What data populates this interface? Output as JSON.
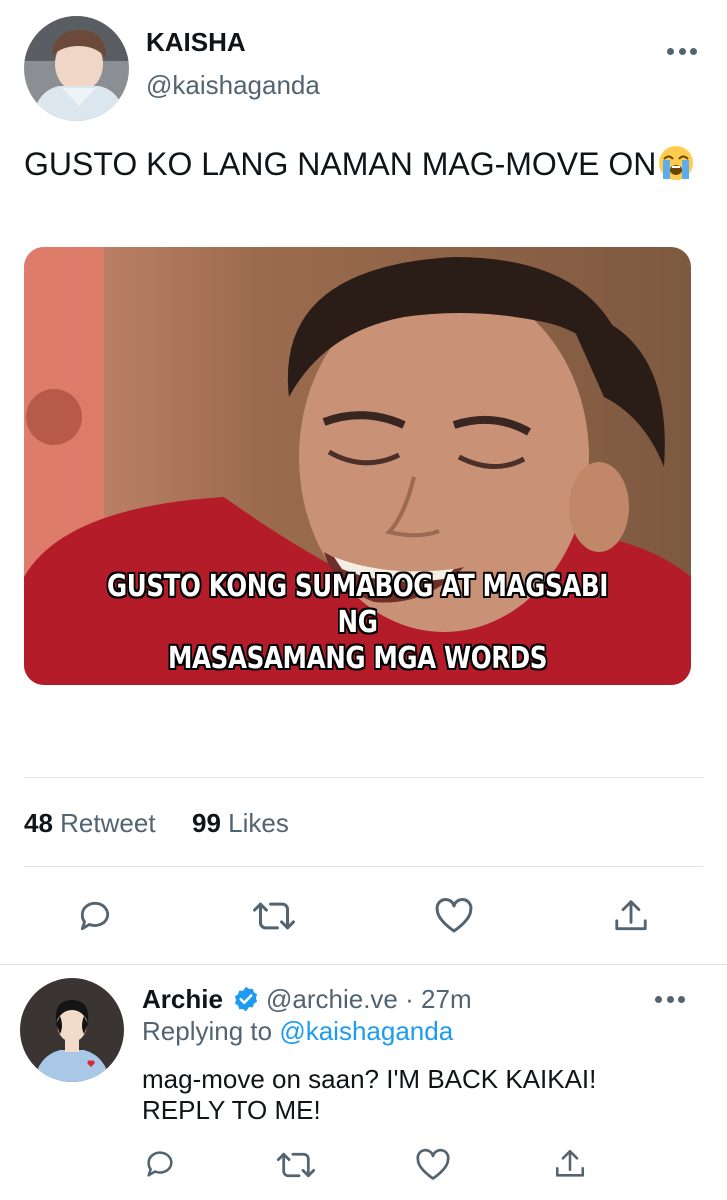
{
  "tweet": {
    "display_name": "KAISHA",
    "handle": "@kaishaganda",
    "text": "GUSTO KO LANG NAMAN MAG-MOVE ON",
    "emoji": "loudly-crying-face",
    "image": {
      "caption_line1": "GUSTO KONG SUMABOG  AT MAGSABI NG",
      "caption_line2": "MASASAMANG MGA WORDS"
    },
    "stats": {
      "retweets": "48",
      "retweets_label": "Retweet",
      "likes": "99",
      "likes_label": "Likes"
    },
    "actions": [
      "reply-icon",
      "retweet-icon",
      "like-icon",
      "share-icon"
    ]
  },
  "reply": {
    "display_name": "Archie",
    "verified": true,
    "handle": "@archie.ve",
    "separator": "·",
    "time": "27m",
    "replying_prefix": "Replying to",
    "replying_to": "@kaishaganda",
    "text_line1": "mag-move on saan? I'M BACK KAIKAI!",
    "text_line2": "REPLY TO ME!"
  },
  "colors": {
    "accent": "#1d9bf0",
    "secondary_text": "#536471",
    "icon": "#536471",
    "divider": "#dde3e8"
  }
}
